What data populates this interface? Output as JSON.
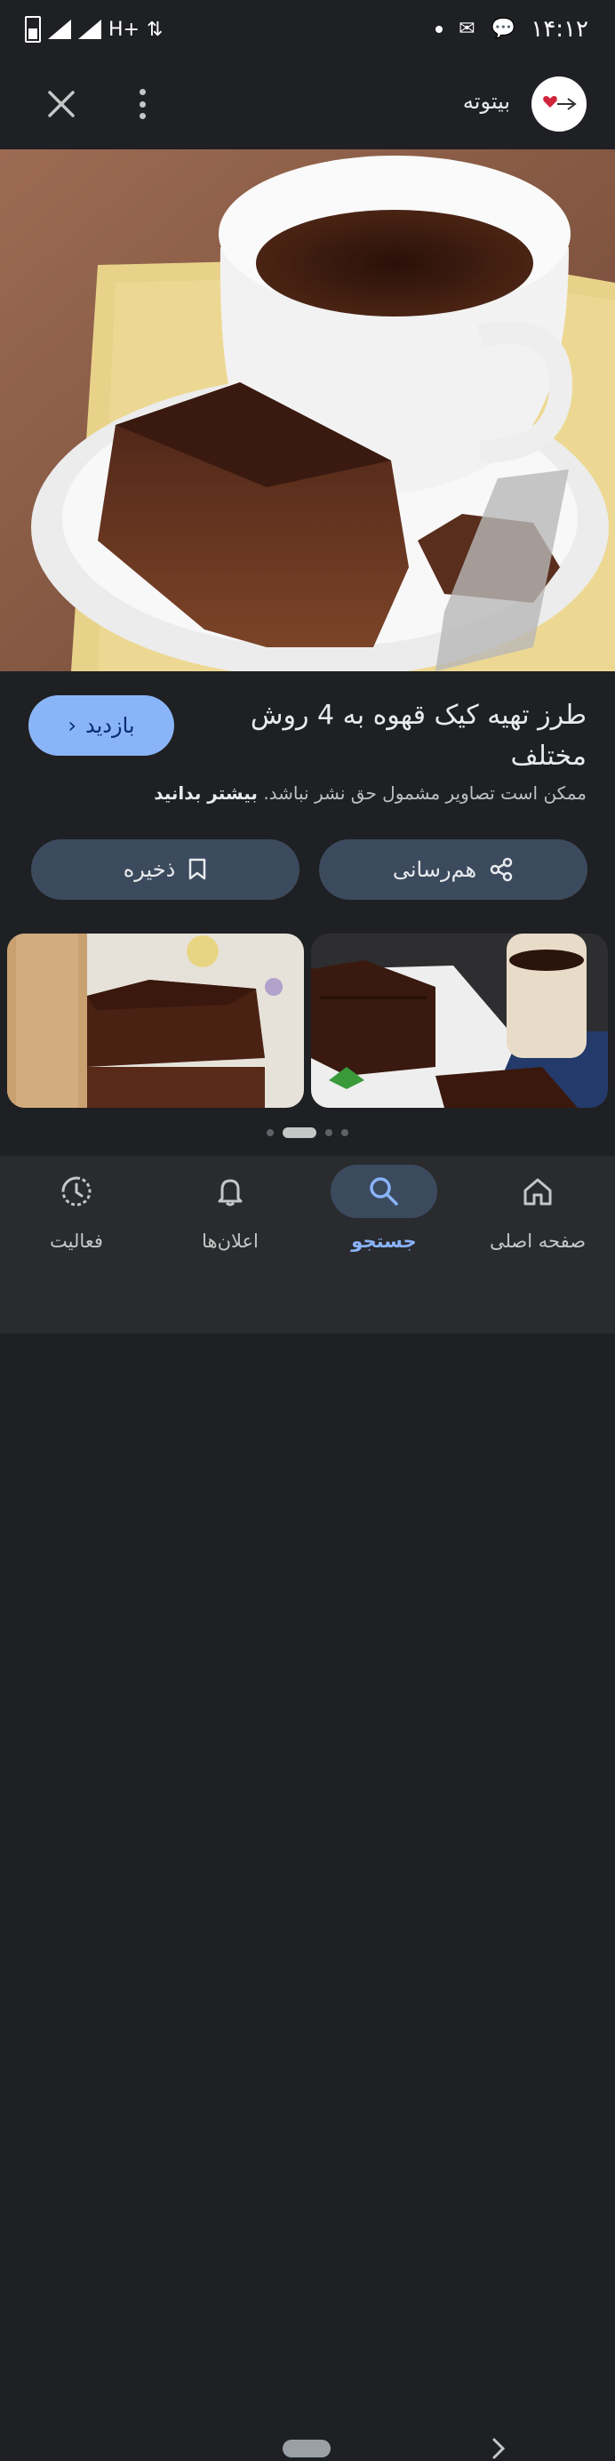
{
  "status_bar": {
    "time": "۱۴:۱۲",
    "network": "H+"
  },
  "header": {
    "site_name": "بیتوته"
  },
  "result": {
    "title": "طرز تهیه کیک قهوه به 4 روش مختلف",
    "visit_label": "بازدید",
    "copyright_text": "ممکن است تصاویر مشمول حق نشر نباشد.",
    "learn_more": "بیشتر بدانید"
  },
  "actions": {
    "share_label": "هم‌رسانی",
    "save_label": "ذخیره"
  },
  "bottom_nav": {
    "home": "صفحه اصلی",
    "search": "جستجو",
    "notifications": "اعلان‌ها",
    "activity": "فعالیت"
  },
  "colors": {
    "accent": "#8ab4f8",
    "button_bg": "#3c4a5e",
    "background": "#1f2023"
  }
}
